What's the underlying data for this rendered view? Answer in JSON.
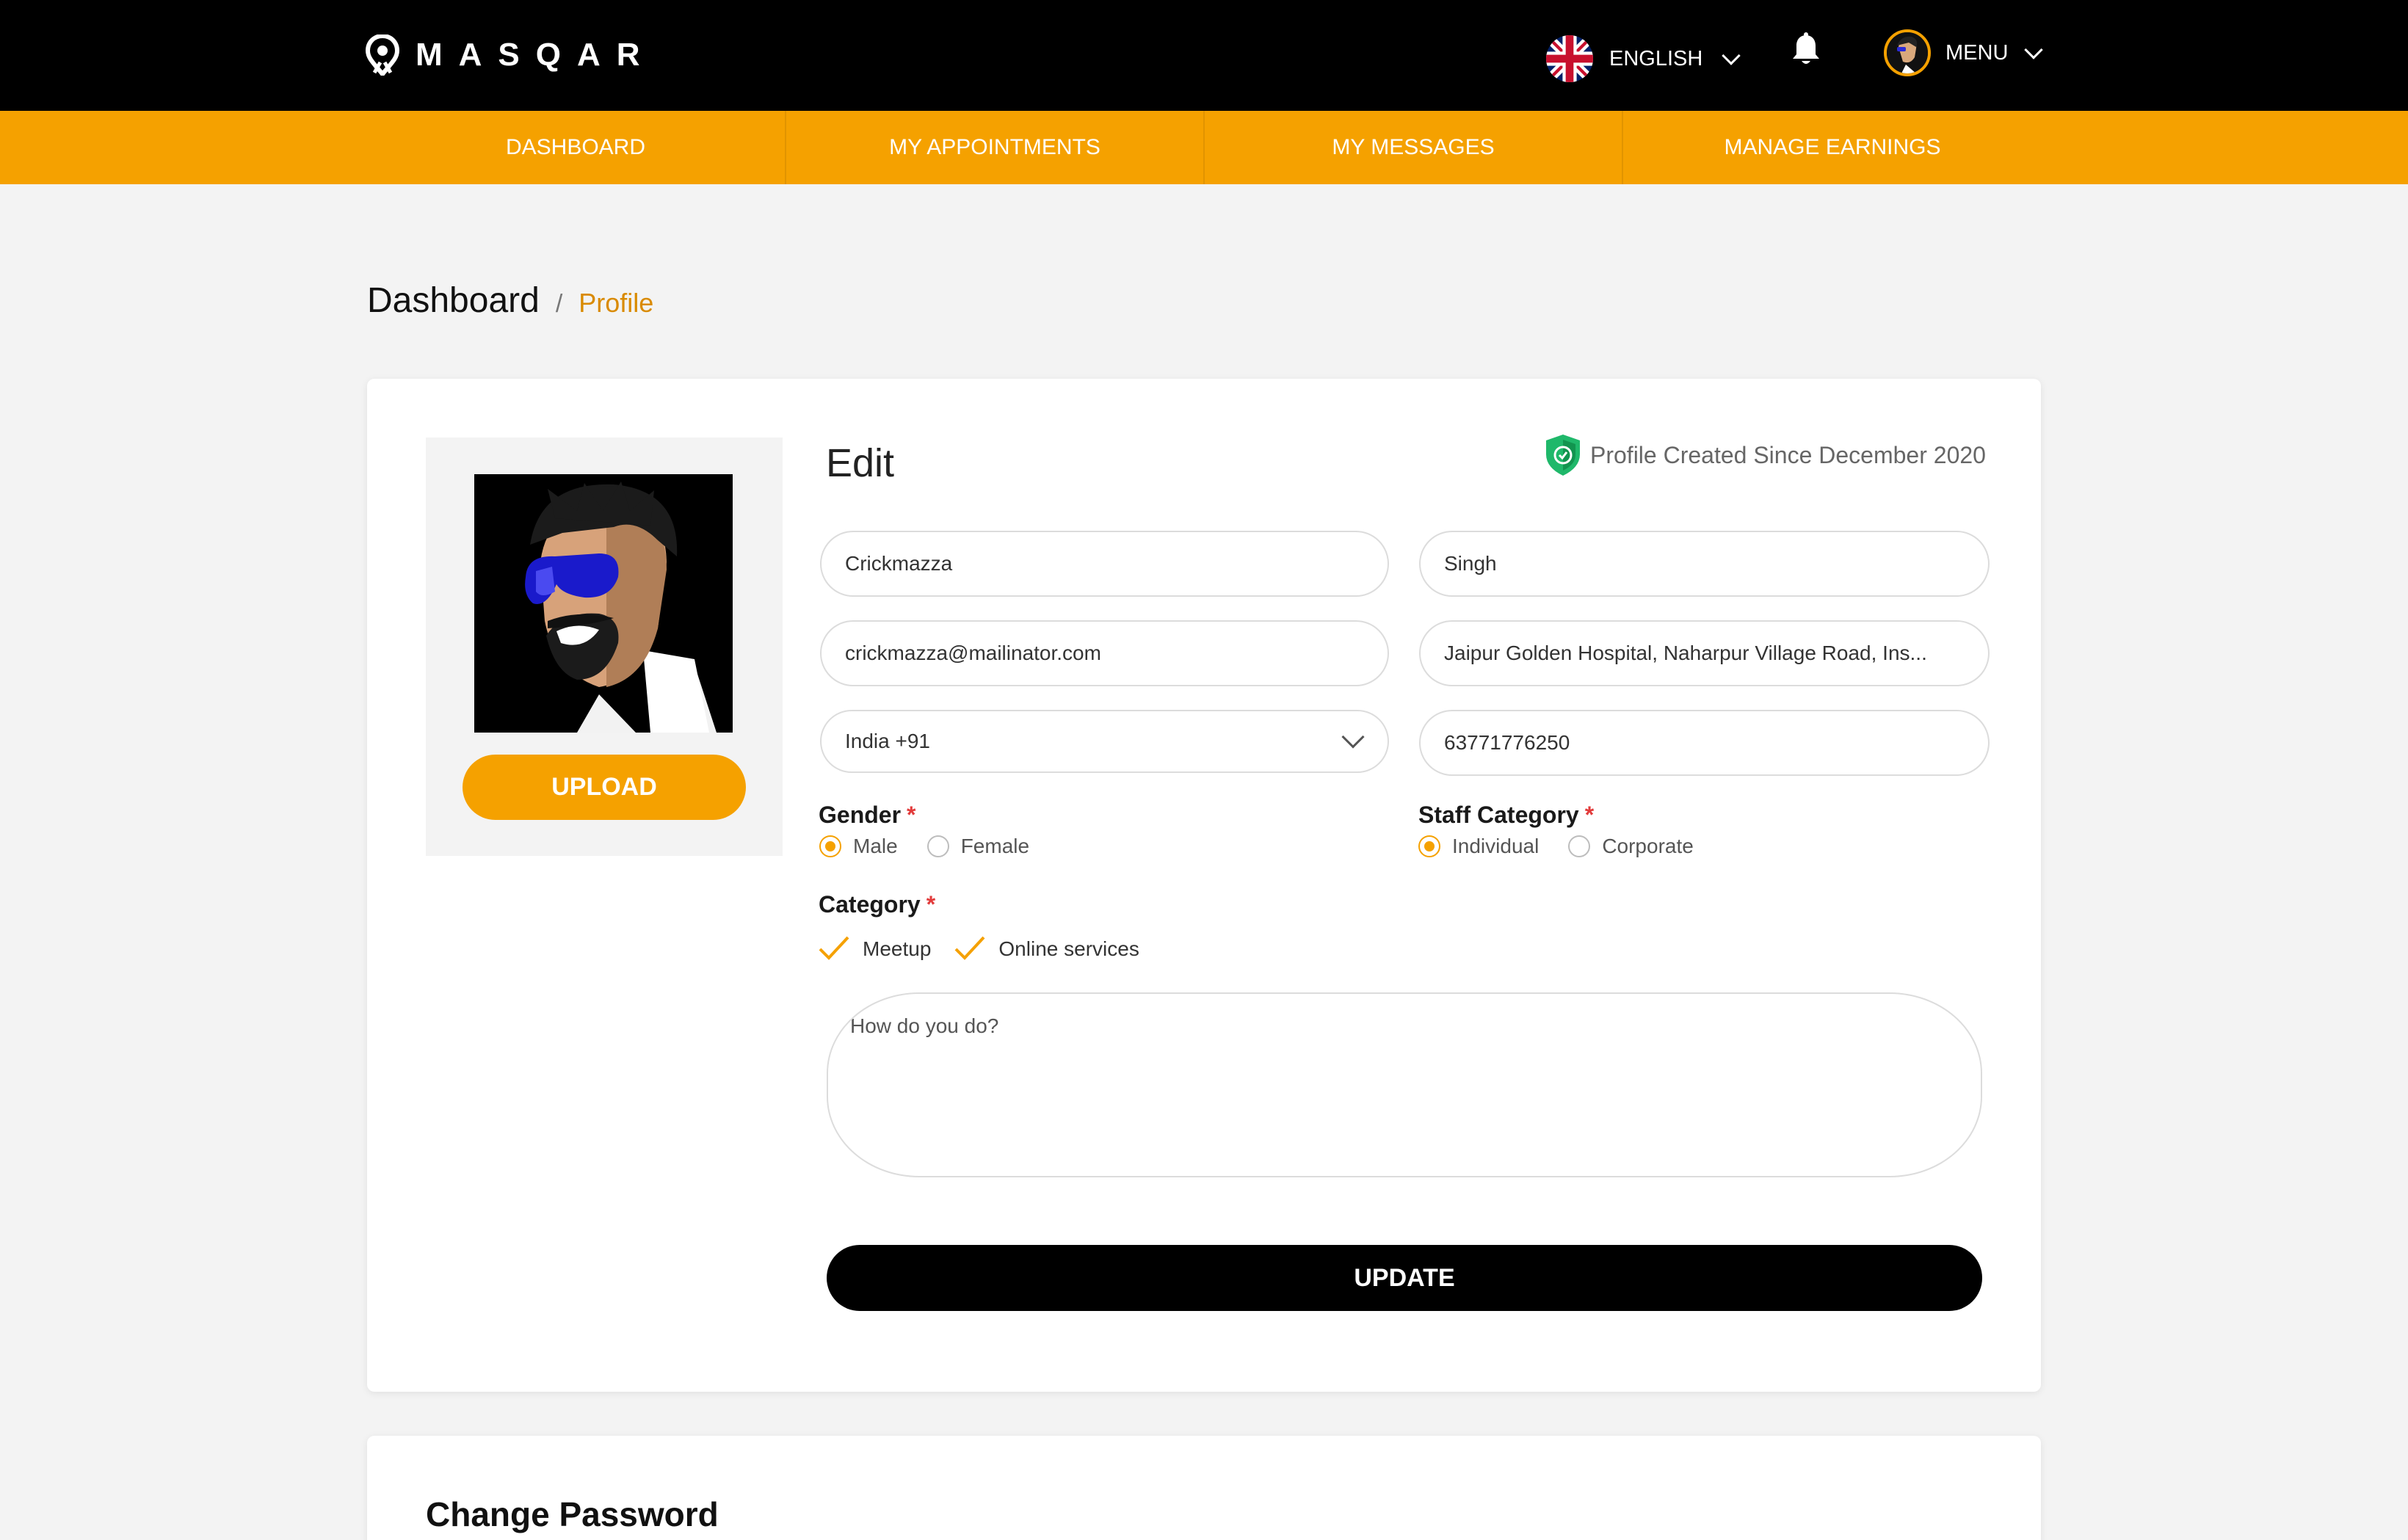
{
  "header": {
    "logo_text": "MASQAR",
    "language": "ENGLISH",
    "menu_label": "MENU"
  },
  "nav": [
    {
      "label": "DASHBOARD"
    },
    {
      "label": "MY APPOINTMENTS"
    },
    {
      "label": "MY MESSAGES"
    },
    {
      "label": "MANAGE EARNINGS"
    }
  ],
  "breadcrumb": {
    "main": "Dashboard",
    "separator": "/",
    "current": "Profile"
  },
  "profile": {
    "upload_label": "UPLOAD",
    "edit_title": "Edit",
    "created_since": "Profile Created Since December 2020",
    "first_name": "Crickmazza",
    "last_name": "Singh",
    "email": "crickmazza@mailinator.com",
    "address": "Jaipur Golden Hospital, Naharpur Village Road, Ins...",
    "country_code": "India +91",
    "phone": "63771776250",
    "gender": {
      "label": "Gender",
      "required": "*",
      "options": [
        "Male",
        "Female"
      ],
      "selected": "Male"
    },
    "staff_category": {
      "label": "Staff Category",
      "required": "*",
      "options": [
        "Individual",
        "Corporate"
      ],
      "selected": "Individual"
    },
    "category": {
      "label": "Category",
      "required": "*",
      "options": [
        "Meetup",
        "Online services"
      ]
    },
    "bio": "How do you do?",
    "update_label": "UPDATE"
  },
  "password": {
    "title": "Change Password"
  },
  "colors": {
    "accent": "#f5a100",
    "topbar": "#000000",
    "success_shield": "#1fb86a",
    "required": "#e23b3b"
  }
}
